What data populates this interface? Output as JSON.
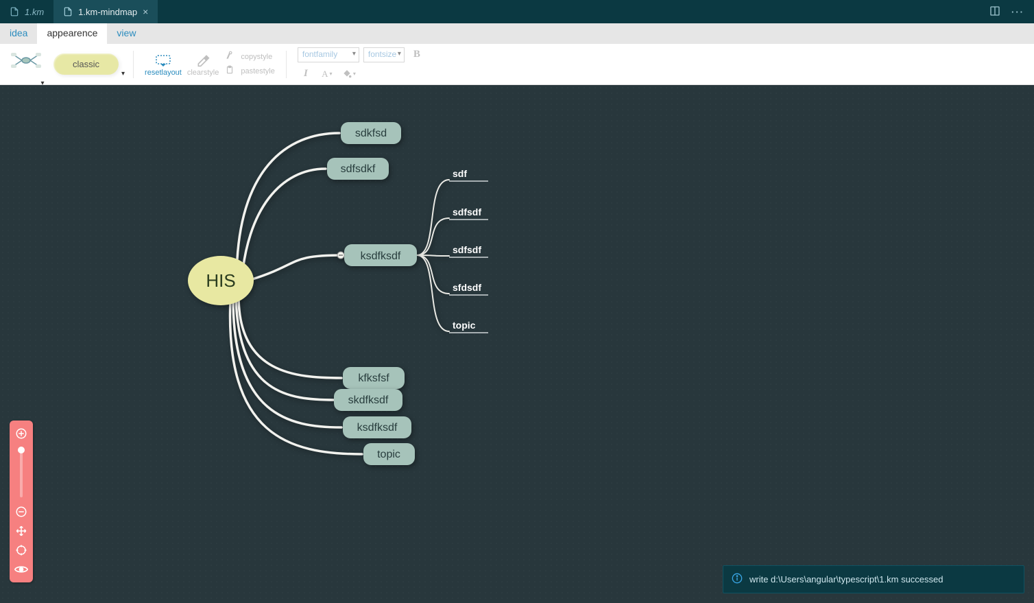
{
  "tabs": {
    "inactive": "1.km",
    "active": "1.km-mindmap"
  },
  "menu": {
    "idea": "idea",
    "appearence": "appearence",
    "view": "view"
  },
  "toolbar": {
    "classic": "classic",
    "resetlayout": "resetlayout",
    "clearstyle": "clearstyle",
    "copystyle": "copystyle",
    "pastestyle": "pastestyle",
    "fontfamily": "fontfamily",
    "fontsize": "fontsize"
  },
  "mindmap": {
    "root": "HIS",
    "c0": "sdkfsd",
    "c1": "sdfsdkf",
    "c2": "ksdfksdf",
    "c3": "kfksfsf",
    "c4": "skdfksdf",
    "c5": "ksdfksdf",
    "c6": "topic",
    "g0": "sdf",
    "g1": "sdfsdf",
    "g2": "sdfsdf",
    "g3": "sfdsdf",
    "g4": "topic"
  },
  "status": {
    "message": "write d:\\Users\\angular\\typescript\\1.km successed"
  }
}
